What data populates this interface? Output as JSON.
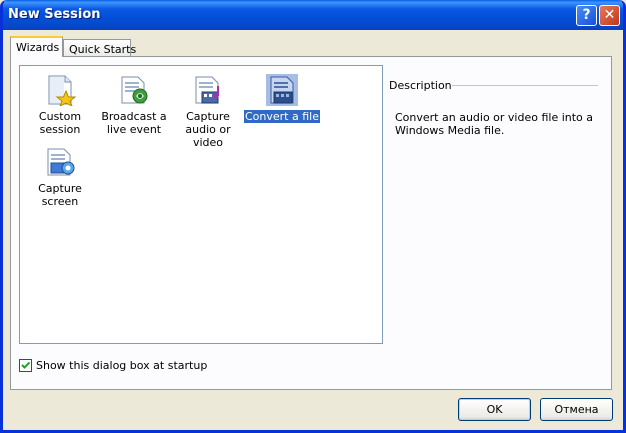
{
  "window": {
    "title": "New Session"
  },
  "titlebar_buttons": {
    "help": "?",
    "close": "✕"
  },
  "tabs": [
    {
      "label": "Wizards",
      "selected": true
    },
    {
      "label": "Quick Starts",
      "selected": false
    }
  ],
  "wizards": [
    {
      "label": "Custom session",
      "icon": "custom-session-icon",
      "selected": false
    },
    {
      "label": "Broadcast a live event",
      "icon": "broadcast-icon",
      "selected": false
    },
    {
      "label": "Capture audio or video",
      "icon": "capture-av-icon",
      "selected": false
    },
    {
      "label": "Convert a file",
      "icon": "convert-file-icon",
      "selected": true
    },
    {
      "label": "Capture screen",
      "icon": "capture-screen-icon",
      "selected": false
    }
  ],
  "description": {
    "heading": "Description",
    "text": "Convert an audio or video file into a Windows Media file."
  },
  "startup": {
    "label": "Show this dialog box at startup",
    "checked": true
  },
  "buttons": {
    "ok": "OK",
    "cancel": "Отмена"
  },
  "colors": {
    "title_bar": "#0a58e3",
    "selection": "#316ac5",
    "dialog_bg": "#ece9d8"
  }
}
